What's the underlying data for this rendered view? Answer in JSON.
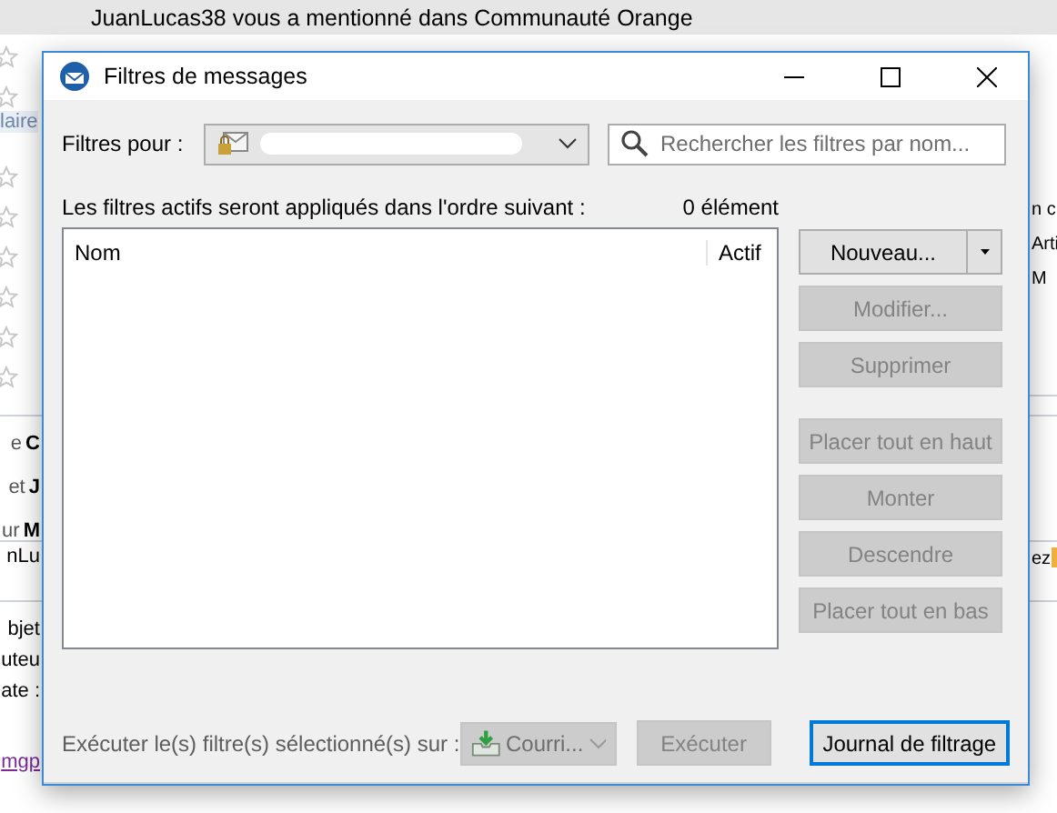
{
  "background": {
    "notification": "JuanLucas38 vous a mentionné dans Communauté Orange",
    "sidebar_fragment": "laire",
    "header_fields": [
      {
        "label": "e",
        "value": "C"
      },
      {
        "label": "et",
        "value": "J"
      },
      {
        "label": "ur",
        "value": "M"
      }
    ],
    "preview_line": "nLu",
    "detail_fields": [
      "bjet",
      "uteu",
      "ate :"
    ],
    "link": "mgp",
    "right_fragments": [
      "n c",
      "Arti",
      "M"
    ],
    "right_preview": "ez"
  },
  "window": {
    "title": "Filtres de messages"
  },
  "filters_for": {
    "label": "Filtres pour :"
  },
  "search": {
    "placeholder": "Rechercher les filtres par nom..."
  },
  "list": {
    "caption": "Les filtres actifs seront appliqués dans l'ordre suivant :",
    "count": "0 élément",
    "columns": [
      "Nom",
      "Actif"
    ]
  },
  "buttons": [
    {
      "label": "Nouveau...",
      "kind": "split",
      "disabled": false
    },
    {
      "label": "Modifier...",
      "kind": "plain",
      "disabled": true
    },
    {
      "label": "Supprimer",
      "kind": "plain",
      "disabled": true
    },
    {
      "label": "Placer tout en haut",
      "kind": "gap",
      "disabled": true
    },
    {
      "label": "Monter",
      "kind": "plain",
      "disabled": true
    },
    {
      "label": "Descendre",
      "kind": "plain",
      "disabled": true
    },
    {
      "label": "Placer tout en bas",
      "kind": "plain",
      "disabled": true
    }
  ],
  "run": {
    "label": "Exécuter le(s) filtre(s) sélectionné(s) sur :",
    "target": "Courri...",
    "target_disabled": true,
    "button": "Exécuter",
    "button_disabled": true
  },
  "log_button": {
    "label": "Journal de filtrage",
    "focused": true
  }
}
